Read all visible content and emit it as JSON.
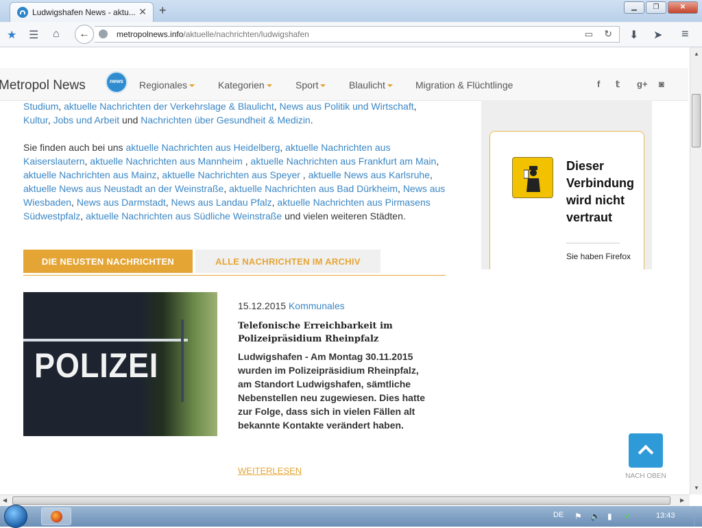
{
  "browser": {
    "tab_title": "Ludwigshafen News - aktu...",
    "url_host": "metropolnews.info",
    "url_path": "/aktuelle/nachrichten/ludwigshafen"
  },
  "site": {
    "brand": "Metropol News",
    "logo_text": "news",
    "menu": [
      "Regionales",
      "Kategorien",
      "Sport",
      "Blaulicht",
      "Migration & Flüchtlinge"
    ],
    "social_icons": [
      "facebook-icon",
      "twitter-icon",
      "google-plus-icon",
      "instagram-icon"
    ]
  },
  "intro": {
    "p1": {
      "l1": "Studium",
      "t1": ", ",
      "l2": "aktuelle Nachrichten der Verkehrslage & Blaulicht",
      "t2": ", ",
      "l3": "News aus Politik und Wirtschaft",
      "t3": ", ",
      "l4": "Kultur",
      "t4": ", ",
      "l5": "Jobs und Arbeit",
      "t5": " und ",
      "l6": "Nachrichten über Gesundheit & Medizin",
      "t6": "."
    },
    "p2": {
      "lead": "Sie finden auch bei uns ",
      "links": [
        "aktuelle Nachrichten aus Heidelberg",
        "aktuelle Nachrichten aus Kaiserslautern",
        "aktuelle Nachrichten aus Mannheim",
        "aktuelle Nachrichten aus Frankfurt am Main",
        "aktuelle Nachrichten aus Mainz",
        "aktuelle Nachrichten aus Speyer",
        "aktuelle News aus Karlsruhe",
        "aktuelle News aus Neustadt an der Weinstraße",
        "aktuelle Nachrichten aus Bad Dürkheim",
        "News aus Wiesbaden",
        "News aus Darmstadt",
        "News aus Landau Pfalz",
        "aktuelle Nachrichten aus Pirmasens Südwestpfalz",
        "aktuelle Nachrichten aus Südliche Weinstraße"
      ],
      "tail": " und vielen weiteren Städten."
    }
  },
  "tabs": {
    "newest": "DIE NEUSTEN NACHRICHTEN",
    "archive": "ALLE NACHRICHTEN IM ARCHIV"
  },
  "article": {
    "image_text": "POLIZEI",
    "date": "15.12.2015",
    "category": "Kommunales",
    "title": "Telefonische Erreichbarkeit im Polizeipräsidium Rheinpfalz",
    "text": "Ludwigshafen - Am Montag 30.11.2015 wurden im Polizeipräsidium Rheinpfalz, am Standort Ludwigshafen, sämtliche Nebenstellen neu zugewiesen. Dies hatte zur Folge, dass sich in vielen Fällen alt bekannte Kontakte verändert haben.",
    "readmore": "WEITERLESEN"
  },
  "sidebar": {
    "warning_title": "Dieser Verbindung wird nicht vertraut",
    "warning_text": "Sie haben Firefox"
  },
  "totop": {
    "label": "NACH OBEN"
  },
  "taskbar": {
    "lang": "DE",
    "time": "13:43"
  }
}
